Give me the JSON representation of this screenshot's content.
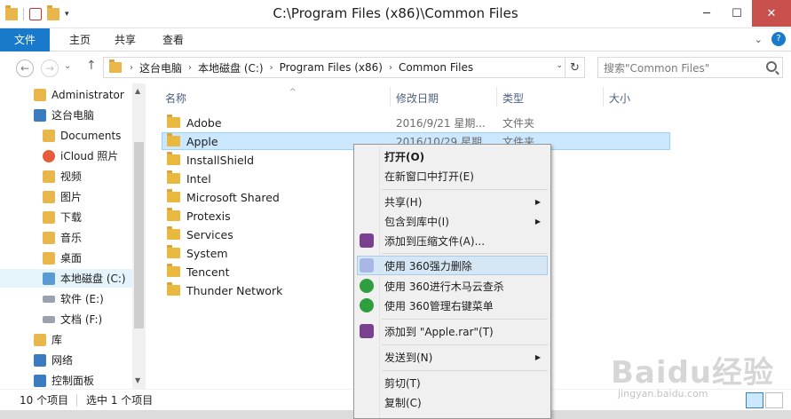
{
  "window": {
    "title": "C:\\Program Files (x86)\\Common Files",
    "minimize": "─",
    "maximize": "☐",
    "close": "✕"
  },
  "ribbon": {
    "tabs": [
      "文件",
      "主页",
      "共享",
      "查看"
    ],
    "expand": "⌄",
    "help": "?"
  },
  "address": {
    "back": "←",
    "forward": "→",
    "up": "↑",
    "segments": [
      "这台电脑",
      "本地磁盘 (C:)",
      "Program Files (x86)",
      "Common Files"
    ],
    "chevron": "›",
    "dropdown": "⌄",
    "refresh": "↻",
    "search_placeholder": "搜索\"Common Files\""
  },
  "nav": {
    "items": [
      {
        "label": "Administrator",
        "icon": "user-folder-icon",
        "color": "#e8b64a"
      },
      {
        "label": "这台电脑",
        "icon": "computer-icon",
        "color": "#3b7bbf"
      },
      {
        "label": "Documents",
        "icon": "folder-icon",
        "color": "#e8b64a"
      },
      {
        "label": "iCloud 照片",
        "icon": "icloud-photos-icon",
        "color": "#e75b3c"
      },
      {
        "label": "视频",
        "icon": "videos-folder-icon",
        "color": "#e8b64a"
      },
      {
        "label": "图片",
        "icon": "pictures-folder-icon",
        "color": "#e8b64a"
      },
      {
        "label": "下载",
        "icon": "downloads-folder-icon",
        "color": "#e8b64a"
      },
      {
        "label": "音乐",
        "icon": "music-folder-icon",
        "color": "#e8b64a"
      },
      {
        "label": "桌面",
        "icon": "desktop-folder-icon",
        "color": "#e8b64a"
      },
      {
        "label": "本地磁盘 (C:)",
        "icon": "system-drive-icon",
        "color": "#5a9bd6"
      },
      {
        "label": "软件 (E:)",
        "icon": "drive-icon",
        "color": "#9aa3ad"
      },
      {
        "label": "文档 (F:)",
        "icon": "drive-icon",
        "color": "#9aa3ad"
      },
      {
        "label": "库",
        "icon": "library-icon",
        "color": "#e8b64a"
      },
      {
        "label": "网络",
        "icon": "network-icon",
        "color": "#3b7bbf"
      },
      {
        "label": "控制面板",
        "icon": "control-panel-icon",
        "color": "#3b7bbf"
      }
    ],
    "scroll_up": "▲",
    "scroll_down": "▼"
  },
  "columns": {
    "name": "名称",
    "date": "修改日期",
    "type": "类型",
    "size": "大小",
    "sort_indicator": "^"
  },
  "files": [
    {
      "name": "Adobe",
      "date": "2016/9/21 星期...",
      "type": "文件夹"
    },
    {
      "name": "Apple",
      "date": "2016/10/29 星期...",
      "type": "文件夹"
    },
    {
      "name": "InstallShield",
      "date": "",
      "type": ""
    },
    {
      "name": "Intel",
      "date": "",
      "type": ""
    },
    {
      "name": "Microsoft Shared",
      "date": "",
      "type": ""
    },
    {
      "name": "Protexis",
      "date": "",
      "type": ""
    },
    {
      "name": "Services",
      "date": "",
      "type": ""
    },
    {
      "name": "System",
      "date": "",
      "type": ""
    },
    {
      "name": "Tencent",
      "date": "",
      "type": ""
    },
    {
      "name": "Thunder Network",
      "date": "",
      "type": ""
    }
  ],
  "status": {
    "count": "10 个项目",
    "selected": "选中 1 个项目"
  },
  "context_menu": {
    "items": [
      {
        "label": "打开(O)",
        "bold": true
      },
      {
        "label": "在新窗口中打开(E)"
      },
      {
        "label": "共享(H)",
        "submenu": true
      },
      {
        "label": "包含到库中(I)",
        "submenu": true
      },
      {
        "label": "添加到压缩文件(A)...",
        "icon": "winrar-icon"
      },
      {
        "label": "使用 360强力删除",
        "icon": "360-delete-icon"
      },
      {
        "label": "使用 360进行木马云查杀",
        "icon": "360-scan-icon"
      },
      {
        "label": "使用 360管理右键菜单",
        "icon": "360-menu-icon"
      },
      {
        "label": "添加到 \"Apple.rar\"(T)",
        "icon": "winrar-icon"
      },
      {
        "label": "发送到(N)",
        "submenu": true
      },
      {
        "label": "剪切(T)"
      },
      {
        "label": "复制(C)"
      }
    ],
    "submenu_arrow": "▶",
    "colors": {
      "winrar": "#7b3f8f",
      "delete360": "#a9b7e6",
      "scan360": "#2e9e3f"
    }
  },
  "watermark": {
    "brand": "Baidu经验",
    "url": "jingyan.baidu.com"
  }
}
